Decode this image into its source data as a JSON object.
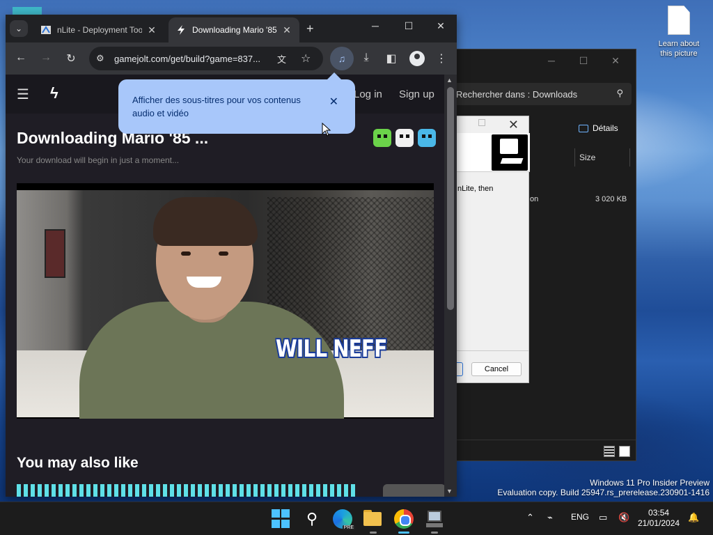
{
  "desktop": {
    "icon_label": "Learn about this picture",
    "watermark_line1": "Windows 11 Pro Insider Preview",
    "watermark_line2": "Evaluation copy. Build 25947.rs_prerelease.230901-1416"
  },
  "explorer": {
    "search_placeholder": "Rechercher dans : Downloads",
    "details_label": "Détails",
    "column_size": "Size",
    "row_name_fragment": "on",
    "row_size": "3 020 KB"
  },
  "nlite_dialog": {
    "text_fragment": "nLite, then",
    "cancel_label": "Cancel"
  },
  "browser": {
    "tabs": [
      {
        "title": "nLite - Deployment Tool"
      },
      {
        "title": "Downloading Mario '85"
      }
    ],
    "url": "gamejolt.com/get/build?game=837..."
  },
  "page": {
    "login_label": "Log in",
    "signup_label": "Sign up",
    "title": "Downloading Mario '85 ...",
    "subtitle": "Your download will begin in just a moment...",
    "video_caption": "WILL NEFF",
    "section_title": "You may also like"
  },
  "caption_bubble": {
    "text": "Afficher des sous-titres pour vos contenus audio et vidéo"
  },
  "taskbar": {
    "language": "ENG",
    "time": "03:54",
    "date": "21/01/2024"
  },
  "colors": {
    "accent": "#4cc2ff",
    "bubble_bg": "#a8c7fa",
    "page_bg": "#1f1d25"
  }
}
